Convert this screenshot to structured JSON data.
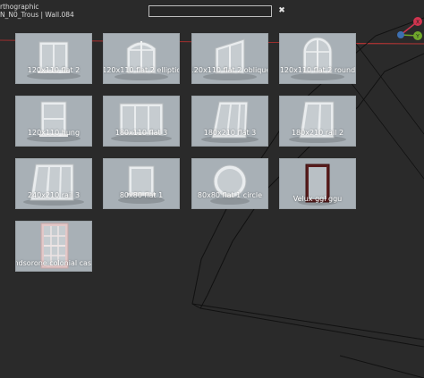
{
  "viewport": {
    "view_mode": "rthographic",
    "object_name": "N_N0_Trous | Wall.084"
  },
  "search": {
    "value": "",
    "placeholder": ""
  },
  "clear_icon": "✖",
  "colors": {
    "background": "#2a2a2a",
    "thumbnail_bg": "#a8b0b6",
    "red_axis": "#c0302f",
    "gizmo_red": "#d0344f",
    "gizmo_green": "#6fa82b"
  },
  "gizmo": {
    "x_label": "X",
    "y_label": "Y"
  },
  "library": {
    "items": [
      {
        "label": "120x110 flat 2",
        "icon": "window-flat-2"
      },
      {
        "label": "120x110 flat 2 elliptic",
        "icon": "window-flat-2-elliptic"
      },
      {
        "label": "120x110 flat 2 oblique",
        "icon": "window-flat-2-oblique"
      },
      {
        "label": "120x110 flat 2 round",
        "icon": "window-flat-2-round"
      },
      {
        "label": "120x110 hung",
        "icon": "window-hung"
      },
      {
        "label": "180x110 flat 3",
        "icon": "window-flat-3"
      },
      {
        "label": "180x210 flat 3",
        "icon": "window-flat-3-tall"
      },
      {
        "label": "180x210 rail 2",
        "icon": "window-rail-2"
      },
      {
        "label": "240x210 rail 3",
        "icon": "window-rail-3"
      },
      {
        "label": "80x80 flat 1",
        "icon": "window-flat-1"
      },
      {
        "label": "80x80 flat 1 circle",
        "icon": "window-circle"
      },
      {
        "label": "Velux ggl ggu",
        "icon": "window-velux"
      },
      {
        "label": "Windsorone colonial casing",
        "icon": "window-colonial"
      }
    ]
  }
}
